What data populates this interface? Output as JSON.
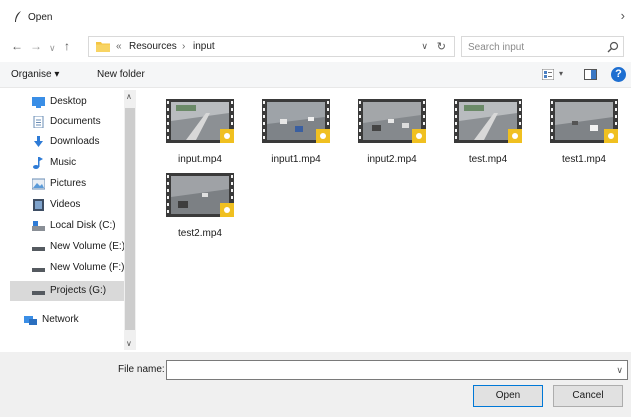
{
  "window": {
    "title": "Open",
    "close_glyph": "›"
  },
  "nav_buttons": {
    "back": "←",
    "forward": "→",
    "recent": "∨",
    "up": "↑"
  },
  "address": {
    "overflow": "«",
    "crumbs": [
      "Resources",
      "input"
    ],
    "separator": "›",
    "dropdown": "∨",
    "refresh": "↻"
  },
  "search": {
    "placeholder": "Search input",
    "value": ""
  },
  "toolbar": {
    "organise_label": "Organise ▾",
    "new_folder_label": "New folder",
    "view_dropdown": "▾",
    "help_label": "?"
  },
  "sidebar": {
    "scroll_up": "∧",
    "scroll_down": "∨",
    "items": [
      {
        "label": "Desktop",
        "icon": "desktop-icon"
      },
      {
        "label": "Documents",
        "icon": "documents-icon"
      },
      {
        "label": "Downloads",
        "icon": "downloads-icon"
      },
      {
        "label": "Music",
        "icon": "music-icon"
      },
      {
        "label": "Pictures",
        "icon": "pictures-icon"
      },
      {
        "label": "Videos",
        "icon": "videos-icon"
      },
      {
        "label": "Local Disk (C:)",
        "icon": "local-disk-icon"
      },
      {
        "label": "New Volume (E:)",
        "icon": "drive-icon"
      },
      {
        "label": "New Volume (F:)",
        "icon": "drive-icon"
      },
      {
        "label": "Projects (G:)",
        "icon": "drive-icon",
        "selected": true
      },
      {
        "label": "Network",
        "icon": "network-icon"
      }
    ]
  },
  "files": [
    {
      "name": "input.mp4"
    },
    {
      "name": "input1.mp4"
    },
    {
      "name": "input2.mp4"
    },
    {
      "name": "test.mp4"
    },
    {
      "name": "test1.mp4"
    },
    {
      "name": "test2.mp4"
    }
  ],
  "footer": {
    "file_name_label": "File name:",
    "file_name_value": "",
    "dropdown": "∨",
    "open_label": "Open",
    "cancel_label": "Cancel"
  },
  "colors": {
    "accent": "#0078d7",
    "help": "#1e6fd1",
    "folder": "#f5c542",
    "vlc_badge": "#f0c020"
  }
}
